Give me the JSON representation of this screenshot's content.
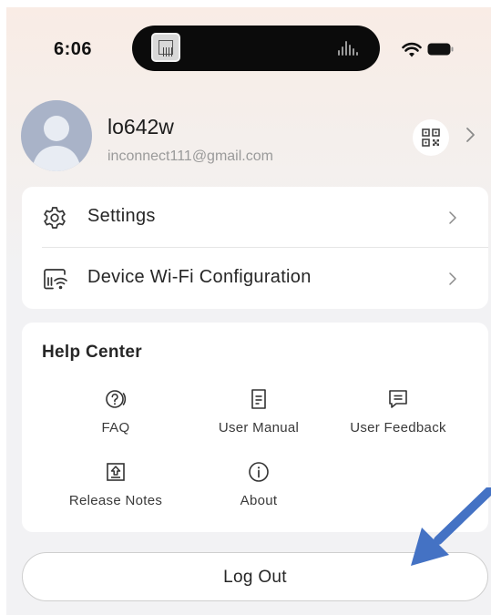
{
  "status_bar": {
    "time": "6:06",
    "icons": [
      "screen-thumbnail-icon",
      "audio-bars-icon",
      "wifi-icon",
      "battery-icon"
    ]
  },
  "profile": {
    "username": "lo642w",
    "email": "inconnect111@gmail.com",
    "icons": [
      "avatar-placeholder-icon",
      "qr-code-icon",
      "chevron-right-icon"
    ]
  },
  "menu": {
    "items": [
      {
        "label": "Settings",
        "icon": "gear-icon"
      },
      {
        "label": "Device Wi-Fi Configuration",
        "icon": "router-wifi-icon"
      }
    ]
  },
  "help_center": {
    "title": "Help Center",
    "items": [
      {
        "label": "FAQ",
        "icon": "question-bubble-icon"
      },
      {
        "label": "User Manual",
        "icon": "document-icon"
      },
      {
        "label": "User Feedback",
        "icon": "chat-bubble-icon"
      },
      {
        "label": "Release Notes",
        "icon": "upload-box-icon"
      },
      {
        "label": "About",
        "icon": "info-circle-icon"
      }
    ]
  },
  "logout": {
    "label": "Log Out"
  },
  "colors": {
    "background": "#f2f2f4",
    "card": "#ffffff",
    "text_primary": "#262626",
    "text_secondary": "#9a9a9a",
    "avatar": "#a9b3c8",
    "annotation_arrow": "#4472c4"
  }
}
